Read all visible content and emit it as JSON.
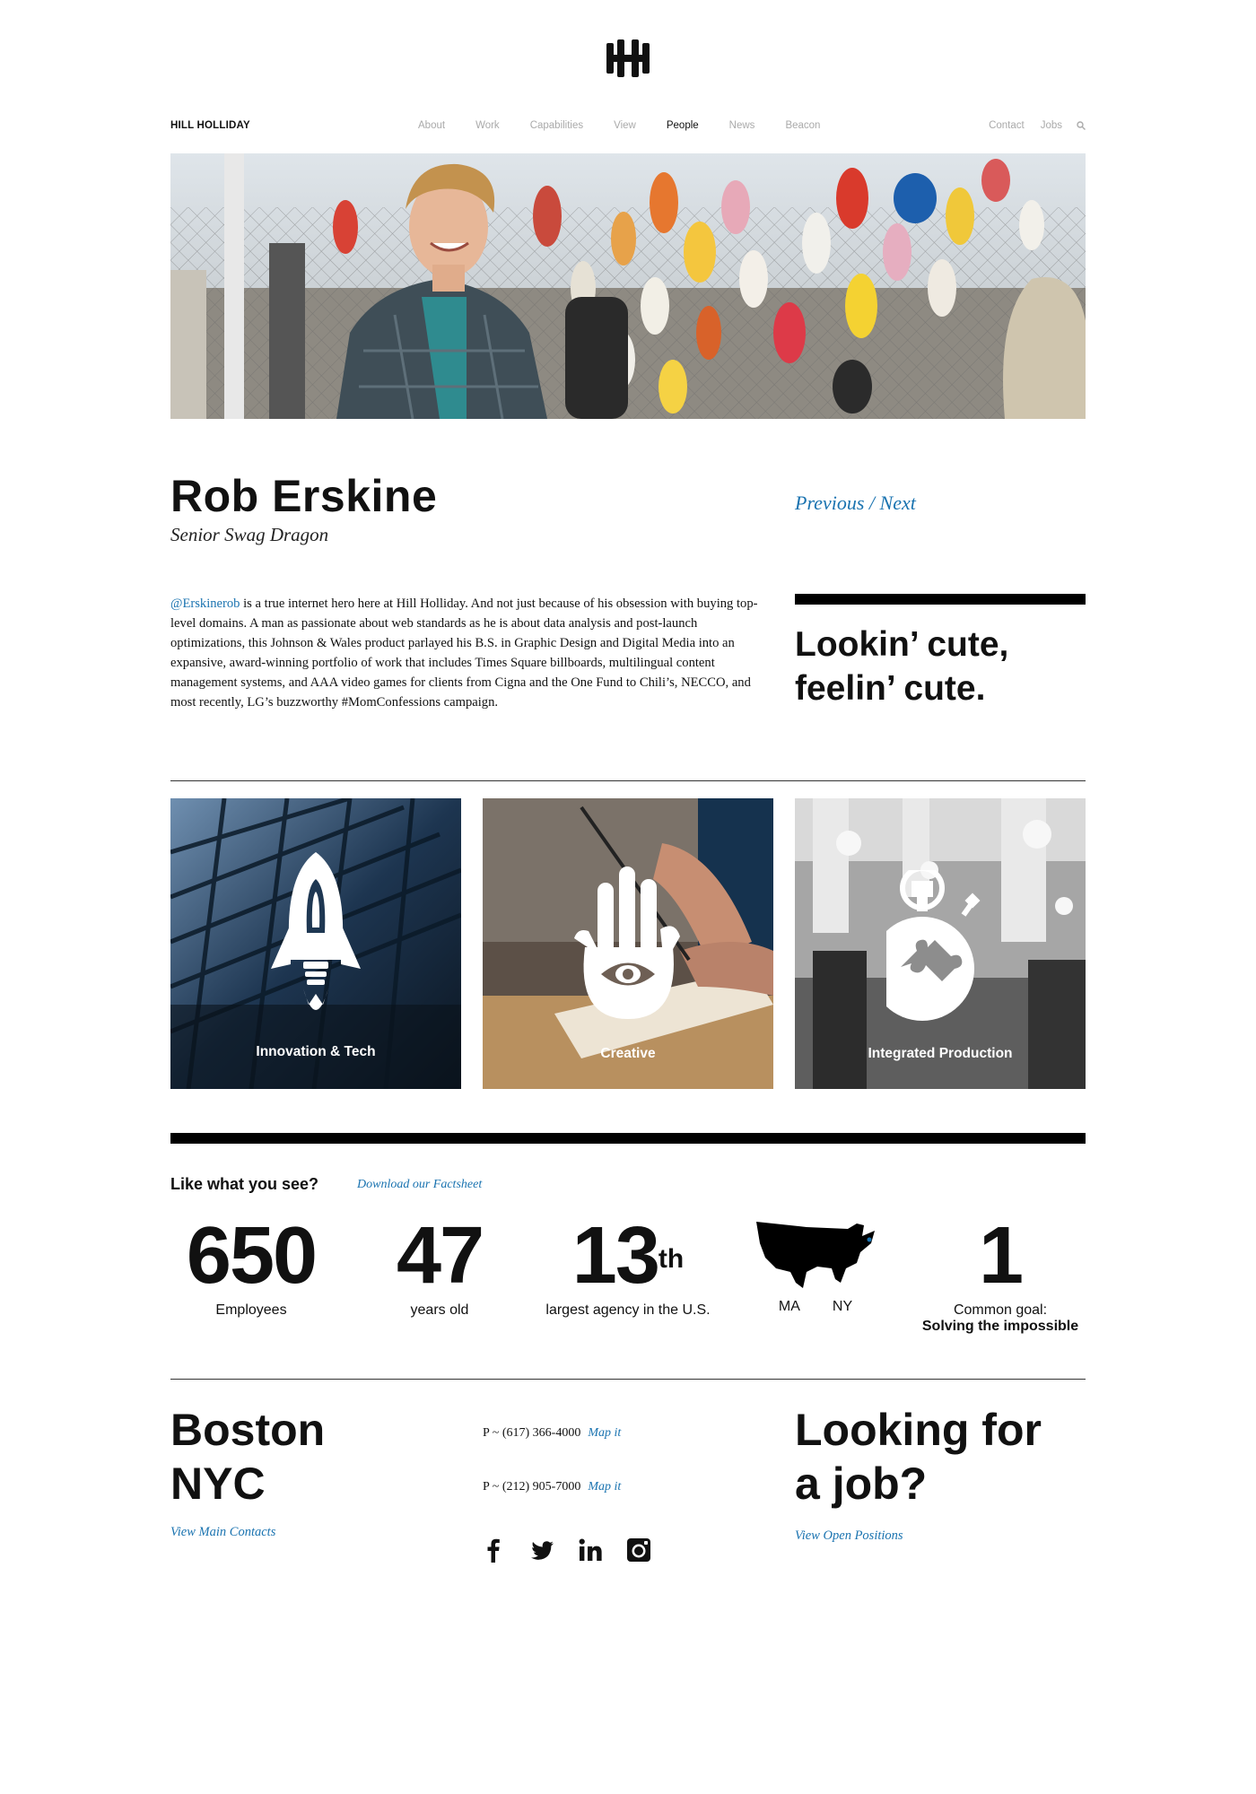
{
  "brand": "HILL HOLLIDAY",
  "nav": {
    "items": [
      "About",
      "Work",
      "Capabilities",
      "View",
      "People",
      "News",
      "Beacon"
    ],
    "active": "People",
    "right": [
      "Contact",
      "Jobs"
    ]
  },
  "person": {
    "name": "Rob Erskine",
    "title": "Senior Swag Dragon",
    "prev": "Previous",
    "separator": " / ",
    "next": "Next",
    "handle": "@Erskinerob",
    "bio": " is a true internet hero here at Hill Holliday. And not just because of his obsession with buying top-level domains. A man as passionate about web standards as he is about data analysis and post-launch optimizations, this Johnson & Wales product parlayed his B.S. in Graphic Design and Digital Media into an expansive, award-winning portfolio of work that includes Times Square billboards, multilingual content management systems, and AAA video games for clients from Cigna and the One Fund to Chili’s, NECCO, and most recently, LG’s buzzworthy #MomConfessions campaign.",
    "quote_line1": "Lookin’ cute,",
    "quote_line2": "feelin’ cute."
  },
  "tiles": [
    {
      "label": "Innovation & Tech"
    },
    {
      "label": "Creative"
    },
    {
      "label": "Integrated Production"
    }
  ],
  "stats_header": {
    "title": "Like what you see?",
    "link": "Download our Factsheet"
  },
  "stats": {
    "employees": {
      "num": "650",
      "cap": "Employees"
    },
    "years": {
      "num": "47",
      "cap": "years old"
    },
    "rank": {
      "num": "13",
      "sup": "th",
      "cap": "largest agency in the U.S."
    },
    "map": {
      "cap1": "MA",
      "cap2": "NY"
    },
    "goal": {
      "num": "1",
      "cap": "Common goal:",
      "cap2": "Solving the impossible"
    }
  },
  "footer": {
    "city1": "Boston",
    "city2": "NYC",
    "contacts_link": "View Main Contacts",
    "phone1": "P ~ (617) 366-4000",
    "phone2": "P ~ (212) 905-7000",
    "mapit": "Map it",
    "job_line1": "Looking for",
    "job_line2": "a job?",
    "jobs_link": "View Open Positions"
  },
  "colors": {
    "link": "#1a73b0",
    "text": "#111111",
    "bar": "#000000"
  },
  "icons": [
    "logo-hh",
    "search-icon",
    "facebook-icon",
    "twitter-icon",
    "linkedin-icon",
    "instagram-icon",
    "rocket-icon",
    "hand-eye-icon",
    "puzzle-icon",
    "us-map"
  ]
}
